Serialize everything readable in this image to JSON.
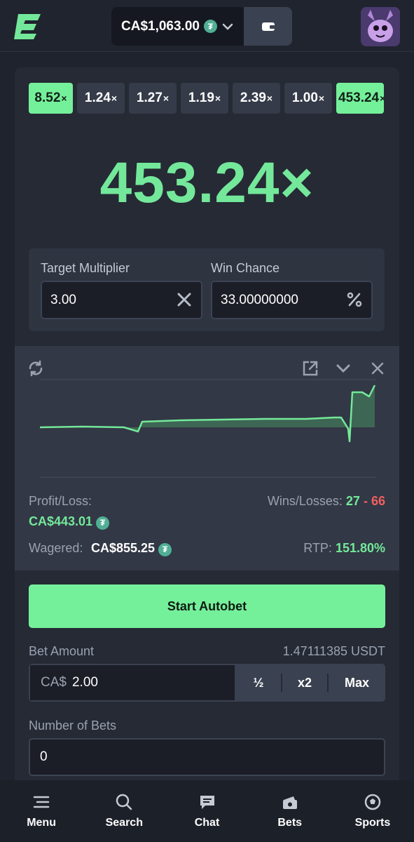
{
  "header": {
    "balance": "CA$1,063.00",
    "currency_icon": "tether-icon",
    "dropdown_icon": "chevron-down-icon",
    "wallet_icon": "wallet-icon",
    "avatar_icon": "avatar"
  },
  "history": [
    {
      "value": "8.52",
      "suffix": "×",
      "win": true
    },
    {
      "value": "1.24",
      "suffix": "×",
      "win": false
    },
    {
      "value": "1.27",
      "suffix": "×",
      "win": false
    },
    {
      "value": "1.19",
      "suffix": "×",
      "win": false
    },
    {
      "value": "2.39",
      "suffix": "×",
      "win": false
    },
    {
      "value": "1.00",
      "suffix": "×",
      "win": false
    },
    {
      "value": "453.24",
      "suffix": "×",
      "win": true
    }
  ],
  "result": {
    "multiplier": "453.24×"
  },
  "params": {
    "target_label": "Target Multiplier",
    "target_value": "3.00",
    "win_chance_label": "Win Chance",
    "win_chance_value": "33.00000000"
  },
  "stats": {
    "profit_label": "Profit/Loss:",
    "profit_value": "CA$443.01",
    "wins_losses_label": "Wins/Losses:",
    "wins": "27",
    "dash": "-",
    "losses": "66",
    "wagered_label": "Wagered:",
    "wagered_value": "CA$855.25",
    "rtp_label": "RTP:",
    "rtp_value": "151.80%"
  },
  "controls": {
    "start_label": "Start Autobet",
    "bet_amount_label": "Bet Amount",
    "bet_amount_usdt": "1.47111385 USDT",
    "currency_prefix": "CA$",
    "bet_amount_value": "2.00",
    "half_label": "½",
    "double_label": "x2",
    "max_label": "Max",
    "num_bets_label": "Number of Bets",
    "num_bets_value": "0"
  },
  "nav": [
    {
      "label": "Menu",
      "icon": "menu-icon"
    },
    {
      "label": "Search",
      "icon": "search-icon"
    },
    {
      "label": "Chat",
      "icon": "chat-icon"
    },
    {
      "label": "Bets",
      "icon": "bets-icon"
    },
    {
      "label": "Sports",
      "icon": "soccer-ball-icon"
    }
  ],
  "colors": {
    "accent": "#75f09a",
    "loss": "#f05f5f",
    "background": "#1f232d"
  }
}
